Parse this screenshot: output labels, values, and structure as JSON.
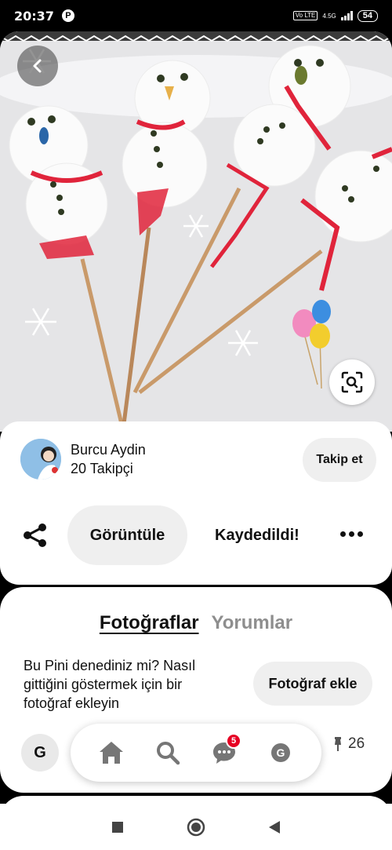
{
  "status_bar": {
    "time": "20:37",
    "volte": "Vo LTE",
    "network": "4.5G",
    "battery": "54"
  },
  "photo": {
    "background_color": "#e7e7e9",
    "icons": [
      "back-arrow-icon",
      "visual-search-icon",
      "snowflake-icon",
      "balloons-icon"
    ]
  },
  "author": {
    "name": "Burcu Aydin",
    "followers": "20 Takipçi",
    "follow_label": "Takip et"
  },
  "actions": {
    "view_label": "Görüntüle",
    "saved_label": "Kaydedildi!"
  },
  "tabs": {
    "photos": "Fotoğraflar",
    "comments": "Yorumlar"
  },
  "tried_prompt": {
    "text": "Bu Pini denediniz mi? Nasıl gittiğini göstermek için bir fotoğraf ekleyin",
    "button_label": "Fotoğraf ekle"
  },
  "bottom_nav": {
    "profile_initial": "G",
    "notifications_badge": "5",
    "pin_count": "26"
  },
  "colors": {
    "brand_red": "#e60023",
    "button_gray": "#efefef"
  }
}
